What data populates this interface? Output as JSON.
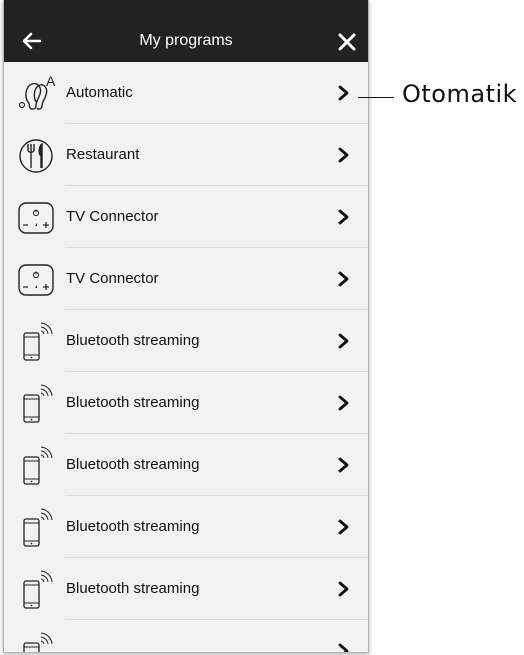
{
  "header": {
    "title": "My programs",
    "back_icon": "arrow-left-icon",
    "close_icon": "close-icon",
    "background": "#222222"
  },
  "programs": [
    {
      "label": "Automatic",
      "icon": "hearing-aid-automatic-icon"
    },
    {
      "label": "Restaurant",
      "icon": "restaurant-icon"
    },
    {
      "label": "TV Connector",
      "icon": "tv-connector-icon"
    },
    {
      "label": "TV Connector",
      "icon": "tv-connector-icon"
    },
    {
      "label": "Bluetooth streaming",
      "icon": "bluetooth-phone-icon"
    },
    {
      "label": "Bluetooth streaming",
      "icon": "bluetooth-phone-icon"
    },
    {
      "label": "Bluetooth streaming",
      "icon": "bluetooth-phone-icon"
    },
    {
      "label": "Bluetooth streaming",
      "icon": "bluetooth-phone-icon"
    },
    {
      "label": "Bluetooth streaming",
      "icon": "bluetooth-phone-icon"
    },
    {
      "label": "",
      "icon": "bluetooth-phone-icon"
    }
  ],
  "row_chevron_icon": "chevron-right-icon",
  "callout": {
    "text": "Otomatik"
  },
  "colors": {
    "list_background": "#f2f2f2",
    "separator": "#dcdcdc"
  }
}
